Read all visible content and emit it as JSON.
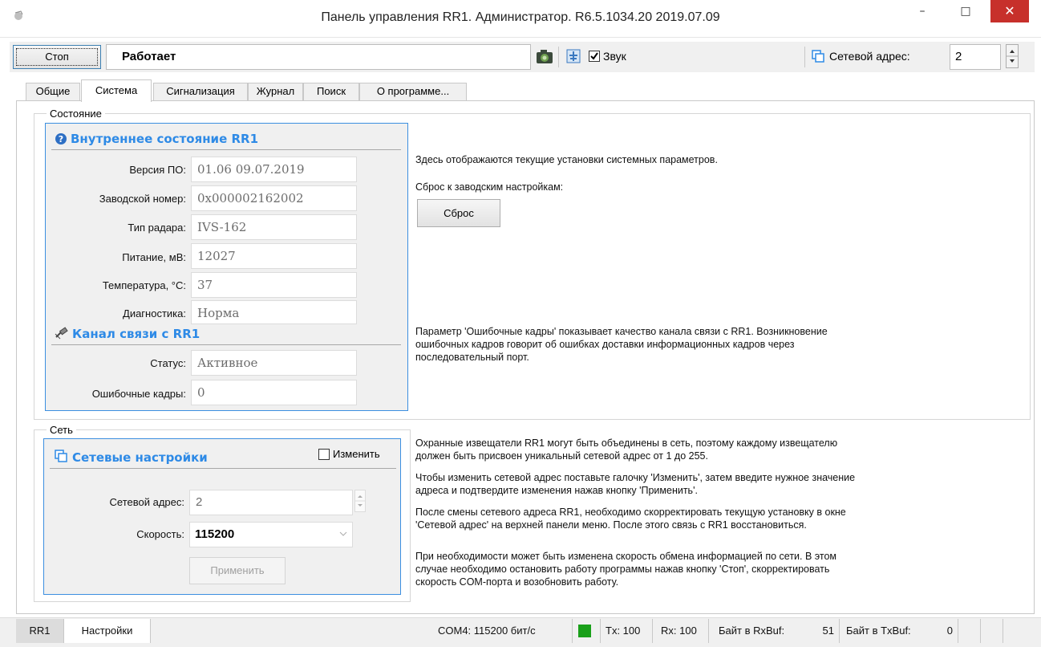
{
  "window": {
    "title": "Панель управления RR1. Администратор. R6.5.1034.20 2019.07.09",
    "minimize_glyph": "–",
    "maximize_glyph": "□",
    "close_glyph": "✕"
  },
  "toolbar": {
    "stop_label": "Стоп",
    "status_text": "Работает",
    "sound_label": "Звук",
    "sound_checked": true,
    "network_address_label": "Сетевой адрес:",
    "network_address_value": "2"
  },
  "tabs": [
    {
      "label": "Общие"
    },
    {
      "label": "Система"
    },
    {
      "label": "Сигнализация"
    },
    {
      "label": "Журнал"
    },
    {
      "label": "Поиск"
    },
    {
      "label": "О программе..."
    }
  ],
  "state_group": {
    "legend": "Состояние",
    "internal": {
      "header": "Внутреннее состояние RR1",
      "fields": [
        {
          "label": "Версия ПО:",
          "value": "01.06 09.07.2019"
        },
        {
          "label": "Заводской номер:",
          "value": "0x000002162002"
        },
        {
          "label": "Тип радара:",
          "value": "IVS-162"
        },
        {
          "label": "Питание, мВ:",
          "value": "12027"
        },
        {
          "label": "Температура, °C:",
          "value": "37"
        },
        {
          "label": "Диагностика:",
          "value": "Норма"
        }
      ]
    },
    "channel": {
      "header": "Канал связи с RR1",
      "fields": [
        {
          "label": "Статус:",
          "value": "Активное"
        },
        {
          "label": "Ошибочные кадры:",
          "value": "0"
        }
      ]
    },
    "info_text": "Здесь отображаются текущие установки системных параметров.",
    "reset_caption": "Сброс к заводским настройкам:",
    "reset_button": "Сброс",
    "frames_text_1": "Параметр 'Ошибочные кадры' показывает качество канала связи с RR1. Возникновение",
    "frames_text_2": "ошибочных кадров говорит об ошибках доставки информационных кадров через",
    "frames_text_3": "последовательный порт."
  },
  "network_group": {
    "legend": "Сеть",
    "header": "Сетевые настройки",
    "change_label": "Изменить",
    "change_checked": false,
    "address_label": "Сетевой адрес:",
    "address_value": "2",
    "speed_label": "Скорость:",
    "speed_value": "115200",
    "apply_button": "Применить",
    "p1_l1": "Охранные извещатели RR1 могут быть объединены в сеть, поэтому каждому извещателю",
    "p1_l2": "должен быть присвоен уникальный сетевой адрес от 1 до 255.",
    "p2_l1": "Чтобы изменить сетевой адрес поставьте галочку 'Изменить', затем введите нужное значение",
    "p2_l2": "адреса и подтвердите изменения нажав кнопку 'Применить'.",
    "p3_l1": "После смены сетевого адреса RR1, необходимо скорректировать текущую установку в окне",
    "p3_l2": "'Сетевой адрес' на верхней панели меню. После этого связь с RR1 восстановиться.",
    "p4_l1": "При необходимости может быть изменена скорость обмена информацией по сети. В этом",
    "p4_l2": "случае необходимо остановить работу программы нажав кнопку 'Стоп', скорректировать",
    "p4_l3": "скорость COM-порта и возобновить работу."
  },
  "statusbar": {
    "tab_rr1": "RR1",
    "tab_settings": "Настройки",
    "port": "COM4: 115200 бит/с",
    "tx": "Tx: 100",
    "rx": "Rx: 100",
    "rxbuf_label": "Байт в RxBuf:",
    "rxbuf_value": "51",
    "txbuf_label": "Байт в TxBuf:",
    "txbuf_value": "0",
    "indicator_color": "#1aa01a"
  },
  "colors": {
    "accent": "#2e8ae6",
    "close_button": "#c7302b"
  }
}
